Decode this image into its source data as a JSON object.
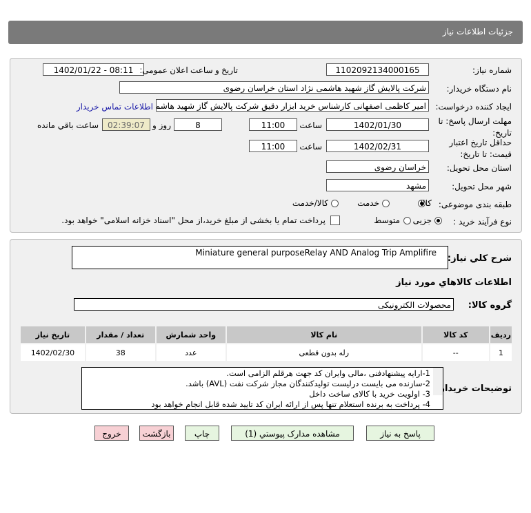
{
  "header": {
    "title": "جزئیات اطلاعات نیاز"
  },
  "form": {
    "need_number_label": "شماره نیاز:",
    "need_number": "1102092134000165",
    "announce_label": "تاریخ و ساعت اعلان عمومی:",
    "announce_value": "1402/01/22 - 08:11",
    "buyer_org_label": "نام دستگاه خریدار:",
    "buyer_org": "شرکت پالایش گاز شهید هاشمی نژاد   استان خراسان رضوی",
    "creator_label": "ایجاد کننده درخواست:",
    "creator": "امیر کاظمی اصفهانی کارشناس خرید ابزار دقیق شرکت پالایش گاز شهید هاشمی نژاد",
    "contact_link": "اطلاعات تماس خریدار",
    "deadline_label": "مهلت ارسال پاسخ: تا تاریخ:",
    "deadline_date": "1402/01/30",
    "time_label": "ساعت",
    "deadline_time": "11:00",
    "days": "8",
    "days_label": "روز و",
    "remaining": "02:39:07",
    "remaining_label": "ساعت باقي مانده",
    "validity_label": "حداقل تاریخ اعتبار قیمت: تا تاریخ:",
    "validity_date": "1402/02/31",
    "validity_time": "11:00",
    "province_label": "استان محل تحویل:",
    "province": "خراسان رضوی",
    "city_label": "شهر محل تحویل:",
    "city": "مشهد",
    "category_label": "طبقه بندی موضوعی:",
    "category_options": [
      "کالا",
      "خدمت",
      "کالا/خدمت"
    ],
    "category_selected": 0,
    "process_label": "نوع فرآیند خرید :",
    "process_options": [
      "جزیی",
      "متوسط"
    ],
    "process_selected": 0,
    "payment_note": "پرداخت تمام یا بخشی از مبلغ خرید،از محل \"اسناد خزانه اسلامی\" خواهد بود."
  },
  "details": {
    "summary_label": "شرح کلي نياز:",
    "summary": "Miniature general purposeRelay AND Analog Trip Amplifire",
    "goods_info_title": "اطلاعات کالاهاي مورد نياز",
    "goods_group_label": "گروه کالا:",
    "goods_group": "محصولات الکترونیکی",
    "table": {
      "headers": [
        "ردیف",
        "کد کالا",
        "نام کالا",
        "واحد شمارش",
        "تعداد / مقدار",
        "تاریخ نیاز"
      ],
      "rows": [
        [
          "1",
          "--",
          "رله بدون قطعی",
          "عدد",
          "38",
          "1402/02/30"
        ]
      ]
    },
    "notes_label": "توضیحات خریدار:",
    "notes": [
      "1-ارایه پیشنهادفنی ،مالی وایران کد جهت هرقلم الزامی است.",
      "2-سازنده می بایست درلیست تولیدکنندگان مجاز شرکت نفت (AVL)  باشد.",
      "3- اولویت خرید با کالای ساخت داخل",
      "4- پرداخت به برنده استعلام تنها پس از ارائه ایران کد تایید شده قابل انجام خواهد بود"
    ]
  },
  "buttons": {
    "reply": "پاسخ به نیاز",
    "attachments": "مشاهده مدارک پیوستي (1)",
    "print": "چاپ",
    "back": "بازگشت",
    "exit": "خروج"
  },
  "colors": {
    "title_bar": "#7a7a7a",
    "panel": "#f0f0f0",
    "green_button": "#e6f5e0",
    "pink_button": "#f7d0d4",
    "remaining_bg": "#efebc8",
    "link": "#1a1aa8"
  }
}
